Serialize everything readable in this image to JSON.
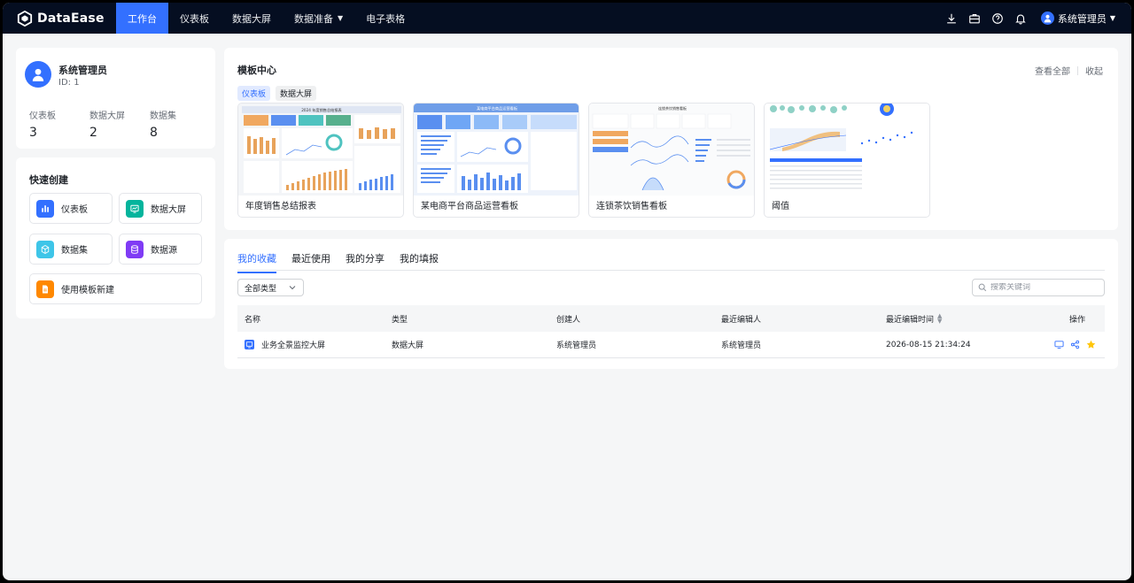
{
  "brand": {
    "name": "DataEase"
  },
  "nav": {
    "items": [
      {
        "label": "工作台",
        "active": true
      },
      {
        "label": "仪表板"
      },
      {
        "label": "数据大屏"
      },
      {
        "label": "数据准备",
        "has_dropdown": true
      },
      {
        "label": "电子表格"
      }
    ]
  },
  "topbar": {
    "icons": [
      "download-icon",
      "briefcase-icon",
      "help-icon",
      "bell-icon"
    ],
    "user_name": "系统管理员"
  },
  "profile": {
    "name": "系统管理员",
    "id": "ID: 1",
    "stats": [
      {
        "label": "仪表板",
        "value": "3"
      },
      {
        "label": "数据大屏",
        "value": "2"
      },
      {
        "label": "数据集",
        "value": "8"
      }
    ]
  },
  "quick_create": {
    "title": "快速创建",
    "items": [
      {
        "label": "仪表板",
        "color": "#3370ff",
        "icon": "bar-chart-icon"
      },
      {
        "label": "数据大屏",
        "color": "#04b49c",
        "icon": "screen-icon"
      },
      {
        "label": "数据集",
        "color": "#3ec5e8",
        "icon": "cube-icon"
      },
      {
        "label": "数据源",
        "color": "#7f3bf5",
        "icon": "database-icon"
      },
      {
        "label": "使用模板新建",
        "color": "#ff8800",
        "icon": "template-icon"
      }
    ]
  },
  "template_center": {
    "title": "模板中心",
    "view_all": "查看全部",
    "collapse": "收起",
    "tags": [
      {
        "label": "仪表板",
        "active": true
      },
      {
        "label": "数据大屏"
      }
    ],
    "templates": [
      {
        "name": "年度销售总结报表",
        "thumb_title": "2024 年度销售总结报表"
      },
      {
        "name": "某电商平台商品运营看板",
        "thumb_title": "某电商平台商品运营看板"
      },
      {
        "name": "连锁茶饮销售看板",
        "thumb_title": "连锁茶饮销售看板"
      },
      {
        "name": "阈值"
      }
    ]
  },
  "favorites": {
    "tabs": [
      {
        "label": "我的收藏",
        "active": true
      },
      {
        "label": "最近使用"
      },
      {
        "label": "我的分享"
      },
      {
        "label": "我的填报"
      }
    ],
    "type_filter": "全部类型",
    "search_placeholder": "搜索关键词",
    "columns": [
      "名称",
      "类型",
      "创建人",
      "最近编辑人",
      "最近编辑时间",
      "操作"
    ],
    "rows": [
      {
        "name": "业务全景监控大屏",
        "type": "数据大屏",
        "creator": "系统管理员",
        "editor": "系统管理员",
        "edited_at": "2026-08-15 21:34:24"
      }
    ],
    "row_actions": [
      "preview-icon",
      "share-icon",
      "star-icon"
    ]
  }
}
